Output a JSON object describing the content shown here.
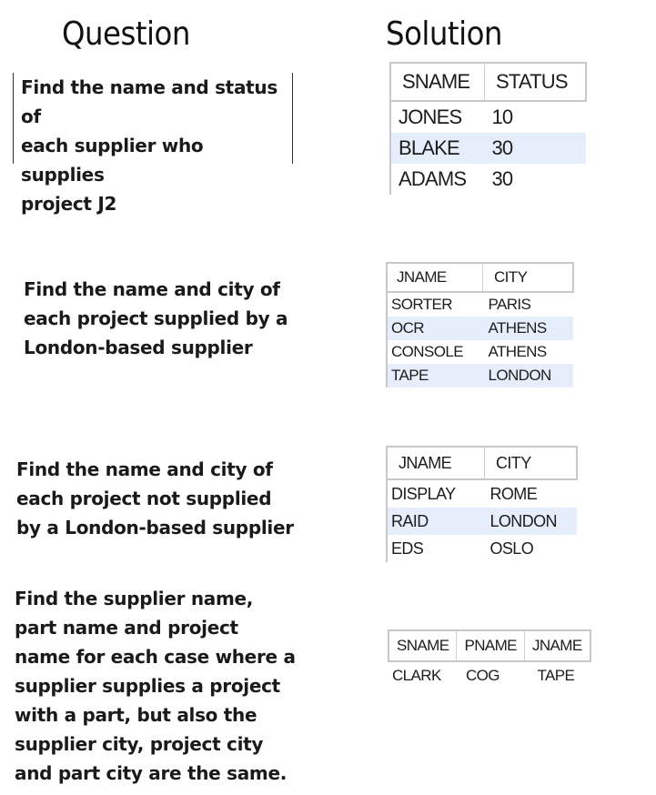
{
  "headings": {
    "question": "Question",
    "solution": "Solution"
  },
  "questions": [
    {
      "lines": [
        "Find the name and status of",
        "each supplier who supplies",
        "project J2"
      ]
    },
    {
      "lines": [
        "Find the name and city of",
        "each project supplied by a",
        "London-based supplier"
      ]
    },
    {
      "lines": [
        "Find the name and city of",
        "each project not supplied",
        "by a London-based supplier"
      ]
    },
    {
      "lines": [
        "Find the supplier name,",
        "part name and project",
        "name for each case where a",
        "supplier supplies a project",
        "with a part, but also the",
        "supplier city, project city",
        "and part city are the same."
      ]
    }
  ],
  "solutions": [
    {
      "columns": [
        "SNAME",
        "STATUS"
      ],
      "rows": [
        [
          "JONES",
          "10"
        ],
        [
          "BLAKE",
          "30"
        ],
        [
          "ADAMS",
          "30"
        ]
      ]
    },
    {
      "columns": [
        "JNAME",
        "CITY"
      ],
      "rows": [
        [
          "SORTER",
          "PARIS"
        ],
        [
          "OCR",
          "ATHENS"
        ],
        [
          "CONSOLE",
          "ATHENS"
        ],
        [
          "TAPE",
          "LONDON"
        ]
      ]
    },
    {
      "columns": [
        "JNAME",
        "CITY"
      ],
      "rows": [
        [
          "DISPLAY",
          "ROME"
        ],
        [
          "RAID",
          "LONDON"
        ],
        [
          "EDS",
          "OSLO"
        ]
      ]
    },
    {
      "columns": [
        "SNAME",
        "PNAME",
        "JNAME"
      ],
      "rows": [
        [
          "CLARK",
          "COG",
          "TAPE"
        ]
      ]
    }
  ],
  "colors": {
    "row_highlight": "#e6eefb",
    "grid_border": "#c8c8c8"
  }
}
